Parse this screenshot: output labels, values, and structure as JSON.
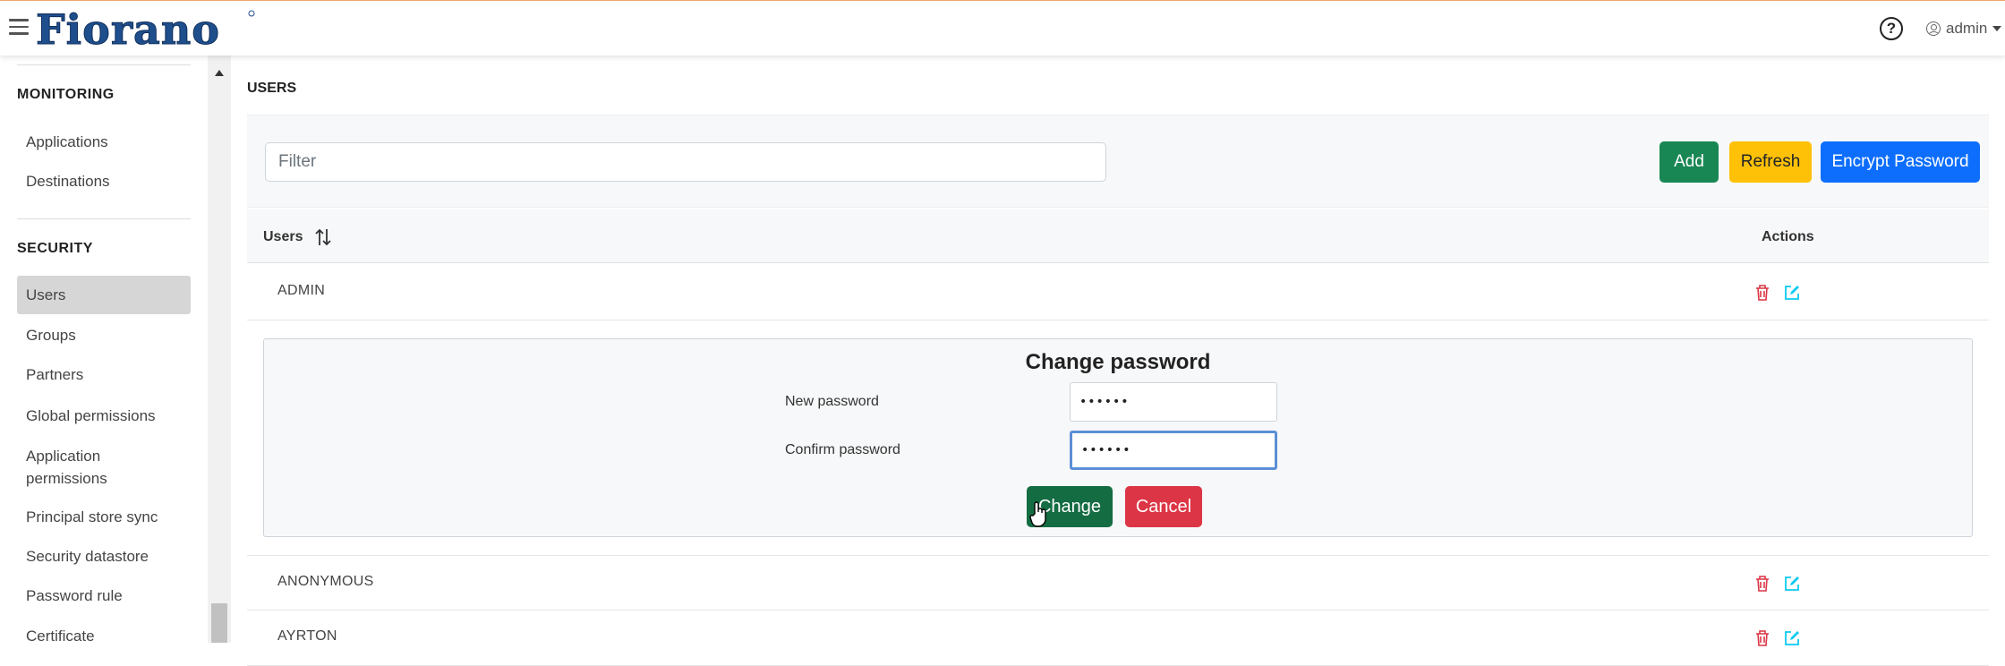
{
  "header": {
    "logo_text": "Fiorano",
    "user_label": "admin"
  },
  "sidebar": {
    "monitoring": {
      "heading": "MONITORING",
      "items": [
        "Applications",
        "Destinations"
      ]
    },
    "security": {
      "heading": "SECURITY",
      "items": [
        "Users",
        "Groups",
        "Partners",
        "Global permissions",
        "Application permissions",
        "Principal store sync",
        "Security datastore",
        "Password rule",
        "Certificate"
      ],
      "active": "Users"
    }
  },
  "main": {
    "title": "USERS",
    "filter_placeholder": "Filter",
    "buttons": {
      "add": "Add",
      "refresh": "Refresh",
      "encrypt": "Encrypt Password"
    },
    "table": {
      "col_users": "Users",
      "col_actions": "Actions",
      "rows": [
        "ADMIN",
        "ANONYMOUS",
        "AYRTON"
      ]
    },
    "change_password": {
      "title": "Change password",
      "new_label": "New password",
      "confirm_label": "Confirm password",
      "new_value": "••••••",
      "confirm_value": "••••••",
      "change_btn": "Change",
      "cancel_btn": "Cancel"
    }
  },
  "colors": {
    "add": "#198754",
    "refresh": "#ffc107",
    "encrypt": "#0d6efd",
    "change": "#146c43",
    "cancel": "#dc3545",
    "logo": "#1f4e8c"
  }
}
